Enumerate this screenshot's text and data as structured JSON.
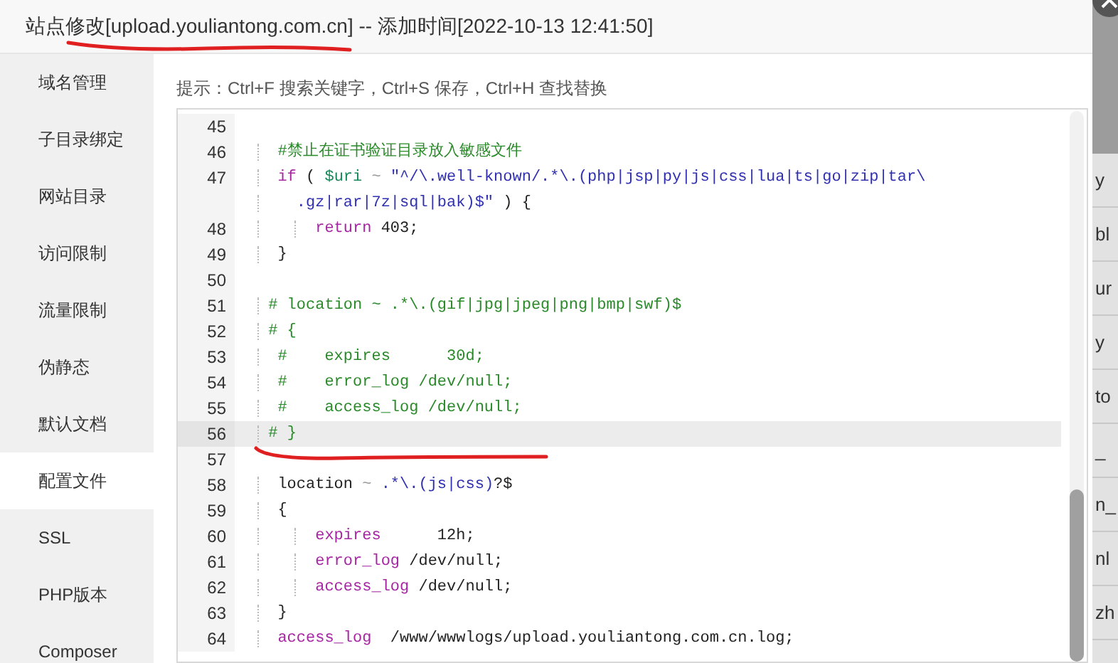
{
  "dialog": {
    "title": "站点修改[upload.youliantong.com.cn] -- 添加时间[2022-10-13 12:41:50]"
  },
  "sidebar": {
    "items": [
      {
        "label": "域名管理",
        "selected": false
      },
      {
        "label": "子目录绑定",
        "selected": false
      },
      {
        "label": "网站目录",
        "selected": false
      },
      {
        "label": "访问限制",
        "selected": false
      },
      {
        "label": "流量限制",
        "selected": false
      },
      {
        "label": "伪静态",
        "selected": false
      },
      {
        "label": "默认文档",
        "selected": false
      },
      {
        "label": "配置文件",
        "selected": true
      },
      {
        "label": "SSL",
        "selected": false
      },
      {
        "label": "PHP版本",
        "selected": false
      },
      {
        "label": "Composer",
        "selected": false
      }
    ]
  },
  "hint": "提示：Ctrl+F 搜索关键字，Ctrl+S 保存，Ctrl+H 查找替换",
  "editor": {
    "lines": [
      {
        "number": "45",
        "active": false
      },
      {
        "number": "46",
        "active": false,
        "segments": [
          {
            "kind": "comment",
            "text": "  #禁止在证书验证目录放入敏感文件"
          }
        ]
      },
      {
        "number": "47",
        "active": false,
        "segments": [
          {
            "kind": "keyword",
            "text": "  if"
          },
          {
            "kind": "plain",
            "text": " ( "
          },
          {
            "kind": "variable",
            "text": "$uri"
          },
          {
            "kind": "operator",
            "text": " ~ "
          },
          {
            "kind": "string",
            "text": "\"^/\\.well-known/.*\\.(php|jsp|py|js|css|lua|ts|go|zip|tar\\"
          }
        ],
        "wrapped_segments": [
          {
            "kind": "string",
            "text": "    .gz|rar|7z|sql|bak)$\""
          },
          {
            "kind": "plain",
            "text": " ) {"
          }
        ]
      },
      {
        "number": "48",
        "active": false,
        "segments": [
          {
            "kind": "keyword",
            "text": "      return"
          },
          {
            "kind": "plain",
            "text": " 403;"
          }
        ]
      },
      {
        "number": "49",
        "active": false,
        "segments": [
          {
            "kind": "plain",
            "text": "  }"
          }
        ]
      },
      {
        "number": "50",
        "active": false
      },
      {
        "number": "51",
        "active": false,
        "segments": [
          {
            "kind": "comment",
            "text": " # location ~ .*\\.(gif|jpg|jpeg|png|bmp|swf)$"
          }
        ]
      },
      {
        "number": "52",
        "active": false,
        "segments": [
          {
            "kind": "comment",
            "text": " # {"
          }
        ]
      },
      {
        "number": "53",
        "active": false,
        "segments": [
          {
            "kind": "comment",
            "text": "  #    expires      30d;"
          }
        ]
      },
      {
        "number": "54",
        "active": false,
        "segments": [
          {
            "kind": "comment",
            "text": "  #    error_log /dev/null;"
          }
        ]
      },
      {
        "number": "55",
        "active": false,
        "segments": [
          {
            "kind": "comment",
            "text": "  #    access_log /dev/null;"
          }
        ]
      },
      {
        "number": "56",
        "active": true,
        "segments": [
          {
            "kind": "comment",
            "text": " #"
          },
          {
            "kind": "comment",
            "text": " }"
          }
        ]
      },
      {
        "number": "57",
        "active": false
      },
      {
        "number": "58",
        "active": false,
        "segments": [
          {
            "kind": "plain",
            "text": "  location"
          },
          {
            "kind": "operator",
            "text": " ~ "
          },
          {
            "kind": "string",
            "text": ".*\\.(js|css)"
          },
          {
            "kind": "plain",
            "text": "?$"
          }
        ]
      },
      {
        "number": "59",
        "active": false,
        "segments": [
          {
            "kind": "plain",
            "text": "  {"
          }
        ]
      },
      {
        "number": "60",
        "active": false,
        "segments": [
          {
            "kind": "keyword",
            "text": "      expires"
          },
          {
            "kind": "plain",
            "text": "      12h;"
          }
        ]
      },
      {
        "number": "61",
        "active": false,
        "segments": [
          {
            "kind": "keyword",
            "text": "      error_log"
          },
          {
            "kind": "plain",
            "text": " /dev/null;"
          }
        ]
      },
      {
        "number": "62",
        "active": false,
        "segments": [
          {
            "kind": "keyword",
            "text": "      access_log"
          },
          {
            "kind": "plain",
            "text": " /dev/null;"
          }
        ]
      },
      {
        "number": "63",
        "active": false,
        "segments": [
          {
            "kind": "plain",
            "text": "  }"
          }
        ]
      },
      {
        "number": "64",
        "active": false,
        "segments": [
          {
            "kind": "keyword",
            "text": "  access_log"
          },
          {
            "kind": "plain",
            "text": "  /www/wwwlogs/upload.youliantong.com.cn.log;"
          }
        ]
      }
    ]
  },
  "background_page": {
    "cells": [
      "y",
      "bl",
      "ur",
      "y",
      "to",
      "_",
      "n_",
      "nl",
      "zh"
    ]
  }
}
